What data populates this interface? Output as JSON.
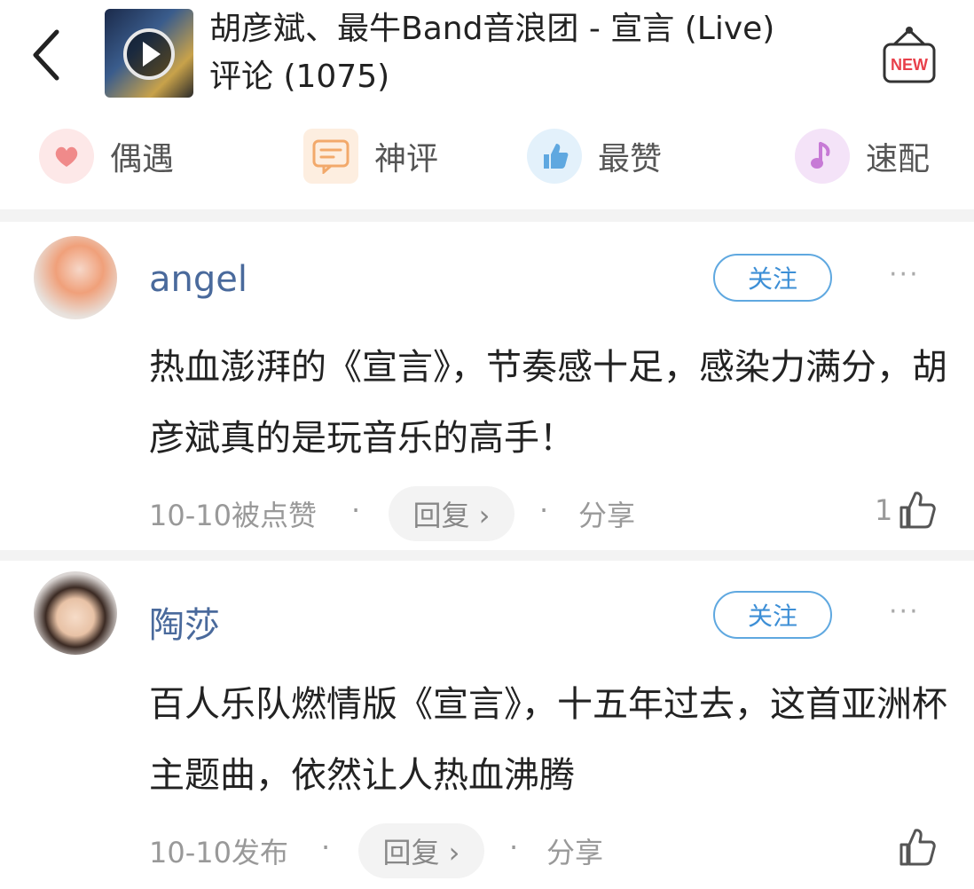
{
  "header": {
    "title_line1": "胡彦斌、最牛Band音浪团 - 宣言 (Live)",
    "title_line2": "评论 (1075)",
    "badge": "NEW"
  },
  "tabs": [
    {
      "label": "偶遇",
      "icon": "heart-chat-icon",
      "color": "#f08a8a"
    },
    {
      "label": "神评",
      "icon": "message-lines-icon",
      "color": "#f2a96b"
    },
    {
      "label": "最赞",
      "icon": "thumbs-up-icon",
      "color": "#5fa8e0"
    },
    {
      "label": "速配",
      "icon": "music-note-icon",
      "color": "#c77ad6"
    }
  ],
  "comments": [
    {
      "username": "angel",
      "follow_label": "关注",
      "more": "···",
      "text": "热血澎湃的《宣言》，节奏感十足，感染力满分，胡彦斌真的是玩音乐的高手！",
      "date": "10-10被点赞",
      "reply_label": "回复 ›",
      "share_label": "分享",
      "likes": "1"
    },
    {
      "username": "陶莎",
      "follow_label": "关注",
      "more": "···",
      "text": "百人乐队燃情版《宣言》，十五年过去，这首亚洲杯主题曲，依然让人热血沸腾",
      "date": "10-10发布",
      "reply_label": "回复 ›",
      "share_label": "分享",
      "likes": ""
    }
  ],
  "separator_dot": "·",
  "colors": {
    "username": "#4a6a9c",
    "follow_border": "#5fa8e0",
    "badge_red": "#e8404a"
  }
}
